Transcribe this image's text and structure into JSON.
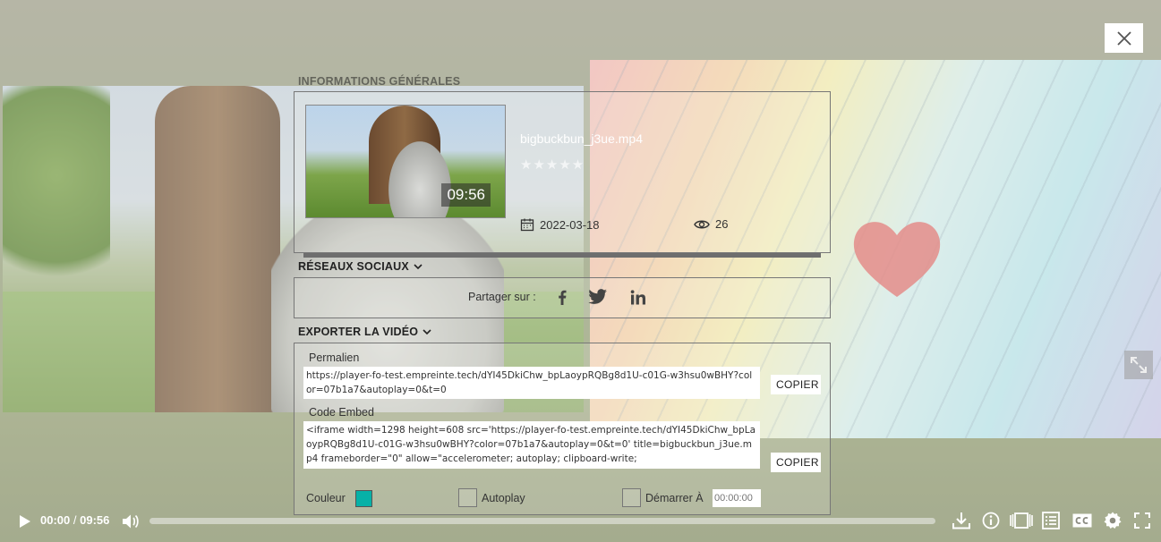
{
  "header": {
    "close_icon": "close-icon",
    "expand_icon": "expand-icon"
  },
  "info": {
    "section_title": "INFORMATIONS GÉNÉRALES",
    "duration": "09:56",
    "filename": "bigbuckbun_j3ue.mp4",
    "rating_stars": "★★★★★",
    "rating": 0,
    "date": "2022-03-18",
    "views": "26"
  },
  "social": {
    "section_title": "RÉSEAUX SOCIAUX",
    "share_label": "Partager sur :",
    "networks": [
      "facebook-icon",
      "twitter-icon",
      "linkedin-icon"
    ]
  },
  "export": {
    "section_title": "EXPORTER LA VIDÉO",
    "permalink_label": "Permalien",
    "permalink_value": "https://player-fo-test.empreinte.tech/dYI45DkiChw_bpLaoypRQBg8d1U-c01G-w3hsu0wBHY?color=07b1a7&autoplay=0&t=0",
    "copy_label": "COPIER",
    "embed_label": "Code Embed",
    "embed_value": "<iframe width=1298 height=608 src='https://player-fo-test.empreinte.tech/dYI45DkiChw_bpLaoypRQBg8d1U-c01G-w3hsu0wBHY?color=07b1a7&autoplay=0&t=0' title=bigbuckbun_j3ue.mp4 frameborder=\"0\" allow=\"accelerometer; autoplay; clipboard-write;",
    "color_label": "Couleur",
    "color_value": "#07b1a7",
    "autoplay_label": "Autoplay",
    "start_label": "Démarrer À",
    "start_placeholder": "00:00:00"
  },
  "player": {
    "current_time": "00:00",
    "separator": "/",
    "total_time": "09:56",
    "progress": 0,
    "icons": [
      "play-icon",
      "volume-icon",
      "download-icon",
      "info-icon",
      "chapters-icon",
      "playlist-icon",
      "subtitles-icon",
      "settings-icon",
      "fullscreen-icon"
    ]
  }
}
